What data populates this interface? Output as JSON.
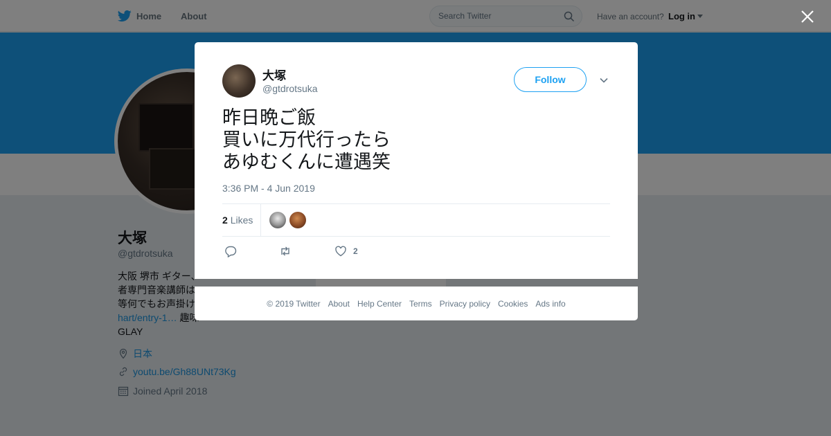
{
  "topnav": {
    "home_label": "Home",
    "about_label": "About",
    "search_placeholder": "Search Twitter",
    "have_account": "Have an account?",
    "login_label": "Log in"
  },
  "profile": {
    "name": "大塚",
    "handle": "@gtdrotsuka",
    "bio_lines": [
      "大阪 堺市 ギター、",
      "者専門音楽講師は",
      "等何でもお声掛け",
      "hart/entry-1… 趣味",
      "GLAY"
    ],
    "bio_link": "hart/entry-1…",
    "bio_suffix": " 趣味",
    "location": "日本",
    "url": "youtu.be/Gh88UNt73Kg",
    "joined": "Joined April 2018"
  },
  "modal": {
    "name": "大塚",
    "handle": "@gtdrotsuka",
    "follow_label": "Follow",
    "tweet_text": "昨日晩ご飯\n買いに万代行ったら\nあゆむくんに遭遇笑",
    "timestamp": "3:36 PM - 4 Jun 2019",
    "likes_count": "2",
    "likes_label": "Likes",
    "action_like_count": "2"
  },
  "footer": {
    "items": [
      "© 2019 Twitter",
      "About",
      "Help Center",
      "Terms",
      "Privacy policy",
      "Cookies",
      "Ads info"
    ]
  },
  "icons": {
    "close": "close-icon",
    "chevron": "chevron-down-icon",
    "reply": "reply-icon",
    "retweet": "retweet-icon",
    "like": "heart-icon"
  },
  "colors": {
    "brand": "#1da1f2",
    "link": "#1b95e0",
    "secondary_text": "#657786"
  }
}
